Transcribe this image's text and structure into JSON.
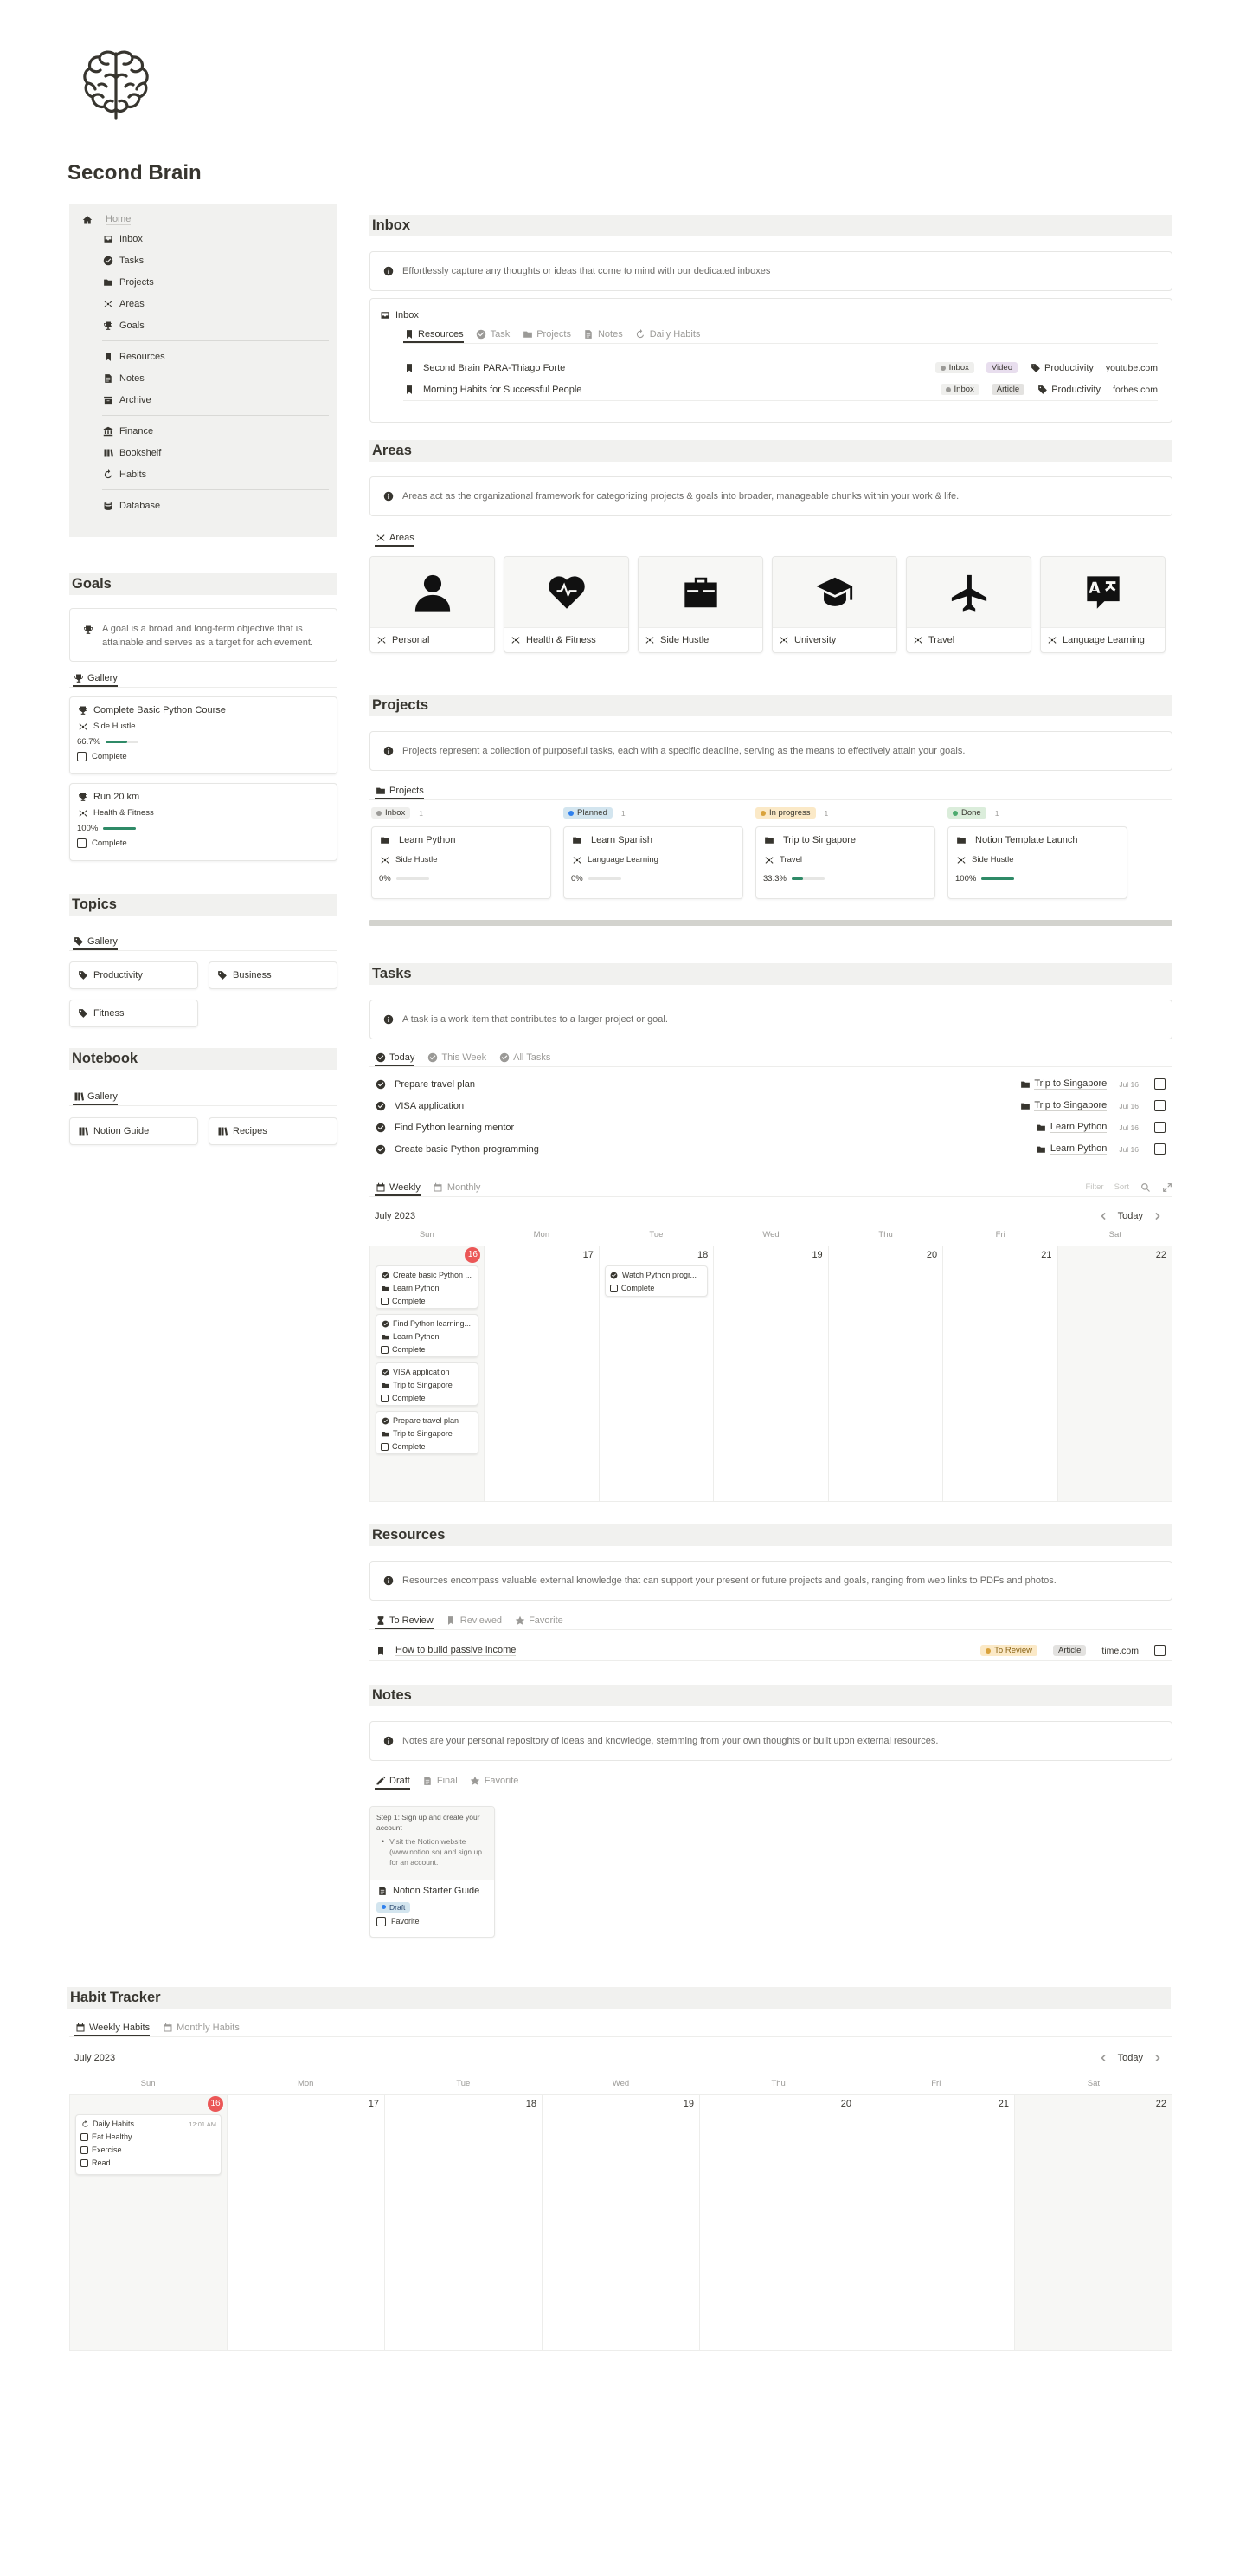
{
  "page": {
    "title": "Second Brain",
    "logo_icon": "brain-icon"
  },
  "sidebar": {
    "home": "Home",
    "items": [
      {
        "label": "Inbox",
        "icon": "inbox-icon"
      },
      {
        "label": "Tasks",
        "icon": "check-circle-icon"
      },
      {
        "label": "Projects",
        "icon": "folder-icon"
      },
      {
        "label": "Areas",
        "icon": "areas-icon"
      },
      {
        "label": "Goals",
        "icon": "trophy-icon"
      },
      {
        "label": "Resources",
        "icon": "bookmark-icon"
      },
      {
        "label": "Notes",
        "icon": "note-icon"
      },
      {
        "label": "Archive",
        "icon": "archive-icon"
      },
      {
        "label": "Finance",
        "icon": "bank-icon"
      },
      {
        "label": "Bookshelf",
        "icon": "books-icon"
      },
      {
        "label": "Habits",
        "icon": "refresh-icon"
      },
      {
        "label": "Database",
        "icon": "database-icon"
      }
    ]
  },
  "goals": {
    "title": "Goals",
    "callout": "A goal is a broad and long-term objective that is attainable and serves as a target for achievement.",
    "tab": "Gallery",
    "cards": [
      {
        "title": "Complete Basic Python Course",
        "area": "Side Hustle",
        "progress_label": "66.7%",
        "progress": 0.667,
        "checkbox": "Complete"
      },
      {
        "title": "Run 20 km",
        "area": "Health & Fitness",
        "progress_label": "100%",
        "progress": 1.0,
        "checkbox": "Complete"
      }
    ]
  },
  "topics": {
    "title": "Topics",
    "tab": "Gallery",
    "items": [
      "Productivity",
      "Business",
      "Fitness"
    ]
  },
  "notebook": {
    "title": "Notebook",
    "tab": "Gallery",
    "items": [
      "Notion Guide",
      "Recipes"
    ]
  },
  "inbox": {
    "title": "Inbox",
    "callout": "Effortlessly capture any thoughts or ideas that come to mind with our dedicated inboxes",
    "db_title": "Inbox",
    "tabs": [
      "Resources",
      "Task",
      "Projects",
      "Notes",
      "Daily Habits"
    ],
    "rows": [
      {
        "title": "Second Brain PARA-Thiago Forte",
        "status": "Inbox",
        "type": "Video",
        "topic": "Productivity",
        "source": "youtube.com"
      },
      {
        "title": "Morning Habits for Successful People",
        "status": "Inbox",
        "type": "Article",
        "topic": "Productivity",
        "source": "forbes.com"
      }
    ]
  },
  "areas": {
    "title": "Areas",
    "callout": "Areas act as the organizational framework for categorizing projects & goals into broader, manageable chunks within your work & life.",
    "tab": "Areas",
    "cards": [
      {
        "label": "Personal",
        "icon": "person-icon"
      },
      {
        "label": "Health & Fitness",
        "icon": "heart-pulse-icon"
      },
      {
        "label": "Side Hustle",
        "icon": "briefcase-icon"
      },
      {
        "label": "University",
        "icon": "graduation-cap-icon"
      },
      {
        "label": "Travel",
        "icon": "airplane-icon"
      },
      {
        "label": "Language Learning",
        "icon": "translate-icon"
      }
    ]
  },
  "projects": {
    "title": "Projects",
    "callout": "Projects represent a collection of purposeful tasks, each with a specific deadline, serving as the means to effectively attain your goals.",
    "tab": "Projects",
    "columns": [
      {
        "status": "Inbox",
        "count": "1",
        "color": "#9b9a97",
        "bg": "#efefed",
        "card": {
          "title": "Learn Python",
          "area": "Side Hustle",
          "progress_label": "0%",
          "progress": 0
        }
      },
      {
        "status": "Planned",
        "count": "1",
        "color": "#2f80ed",
        "bg": "#d3e5ef",
        "card": {
          "title": "Learn Spanish",
          "area": "Language Learning",
          "progress_label": "0%",
          "progress": 0
        }
      },
      {
        "status": "In progress",
        "count": "1",
        "color": "#d9a23c",
        "bg": "#fbe9c7",
        "card": {
          "title": "Trip to Singapore",
          "area": "Travel",
          "progress_label": "33.3%",
          "progress": 0.333
        }
      },
      {
        "status": "Done",
        "count": "1",
        "color": "#4dab6e",
        "bg": "#dbeddb",
        "card": {
          "title": "Notion Template Launch",
          "area": "Side Hustle",
          "progress_label": "100%",
          "progress": 1.0
        }
      }
    ]
  },
  "tasks": {
    "title": "Tasks",
    "callout": "A task is a work item that contributes to a larger project or goal.",
    "tabs": [
      "Today",
      "This Week",
      "All Tasks"
    ],
    "rows": [
      {
        "title": "Prepare travel plan",
        "project": "Trip to Singapore",
        "date": "Jul 16"
      },
      {
        "title": "VISA application",
        "project": "Trip to Singapore",
        "date": "Jul 16"
      },
      {
        "title": "Find Python learning mentor",
        "project": "Learn Python",
        "date": "Jul 16"
      },
      {
        "title": "Create basic Python programming",
        "project": "Learn Python",
        "date": "Jul 16"
      }
    ],
    "cal_tabs": [
      "Weekly",
      "Monthly"
    ],
    "cal_tools": [
      "Filter",
      "Sort"
    ],
    "month": "July 2023",
    "today_label": "Today",
    "days": [
      "Sun",
      "Mon",
      "Tue",
      "Wed",
      "Thu",
      "Fri",
      "Sat"
    ],
    "dates": [
      "16",
      "17",
      "18",
      "19",
      "20",
      "21",
      "22"
    ],
    "events_sun": [
      {
        "title": "Create basic Python ...",
        "project": "Learn Python",
        "checkbox": "Complete"
      },
      {
        "title": "Find Python learning...",
        "project": "Learn Python",
        "checkbox": "Complete"
      },
      {
        "title": "VISA application",
        "project": "Trip to Singapore",
        "checkbox": "Complete"
      },
      {
        "title": "Prepare travel plan",
        "project": "Trip to Singapore",
        "checkbox": "Complete"
      }
    ],
    "event_tue": {
      "title": "Watch Python progr...",
      "checkbox": "Complete"
    }
  },
  "resources": {
    "title": "Resources",
    "callout": "Resources encompass valuable external knowledge that can support your present or future projects and goals, ranging from web links to PDFs and photos.",
    "tabs": [
      "To Review",
      "Reviewed",
      "Favorite"
    ],
    "row": {
      "title": "How to build passive income",
      "status": "To Review",
      "type": "Article",
      "source": "time.com"
    }
  },
  "notes": {
    "title": "Notes",
    "callout": "Notes are your personal repository of ideas and knowledge, stemming from your own thoughts or built upon external resources.",
    "tabs": [
      "Draft",
      "Final",
      "Favorite"
    ],
    "card": {
      "preview_heading": "Step 1: Sign up and create your account",
      "preview_bullet": "Visit the Notion website (www.notion.so) and sign up for an account.",
      "title": "Notion Starter Guide",
      "status": "Draft",
      "checkbox": "Favorite"
    }
  },
  "habits": {
    "title": "Habit Tracker",
    "tabs": [
      "Weekly Habits",
      "Monthly Habits"
    ],
    "month": "July 2023",
    "today_label": "Today",
    "days": [
      "Sun",
      "Mon",
      "Tue",
      "Wed",
      "Thu",
      "Fri",
      "Sat"
    ],
    "dates": [
      "16",
      "17",
      "18",
      "19",
      "20",
      "21",
      "22"
    ],
    "event": {
      "title": "Daily Habits",
      "time": "12:01 AM",
      "items": [
        "Eat Healthy",
        "Exercise",
        "Read"
      ]
    }
  }
}
